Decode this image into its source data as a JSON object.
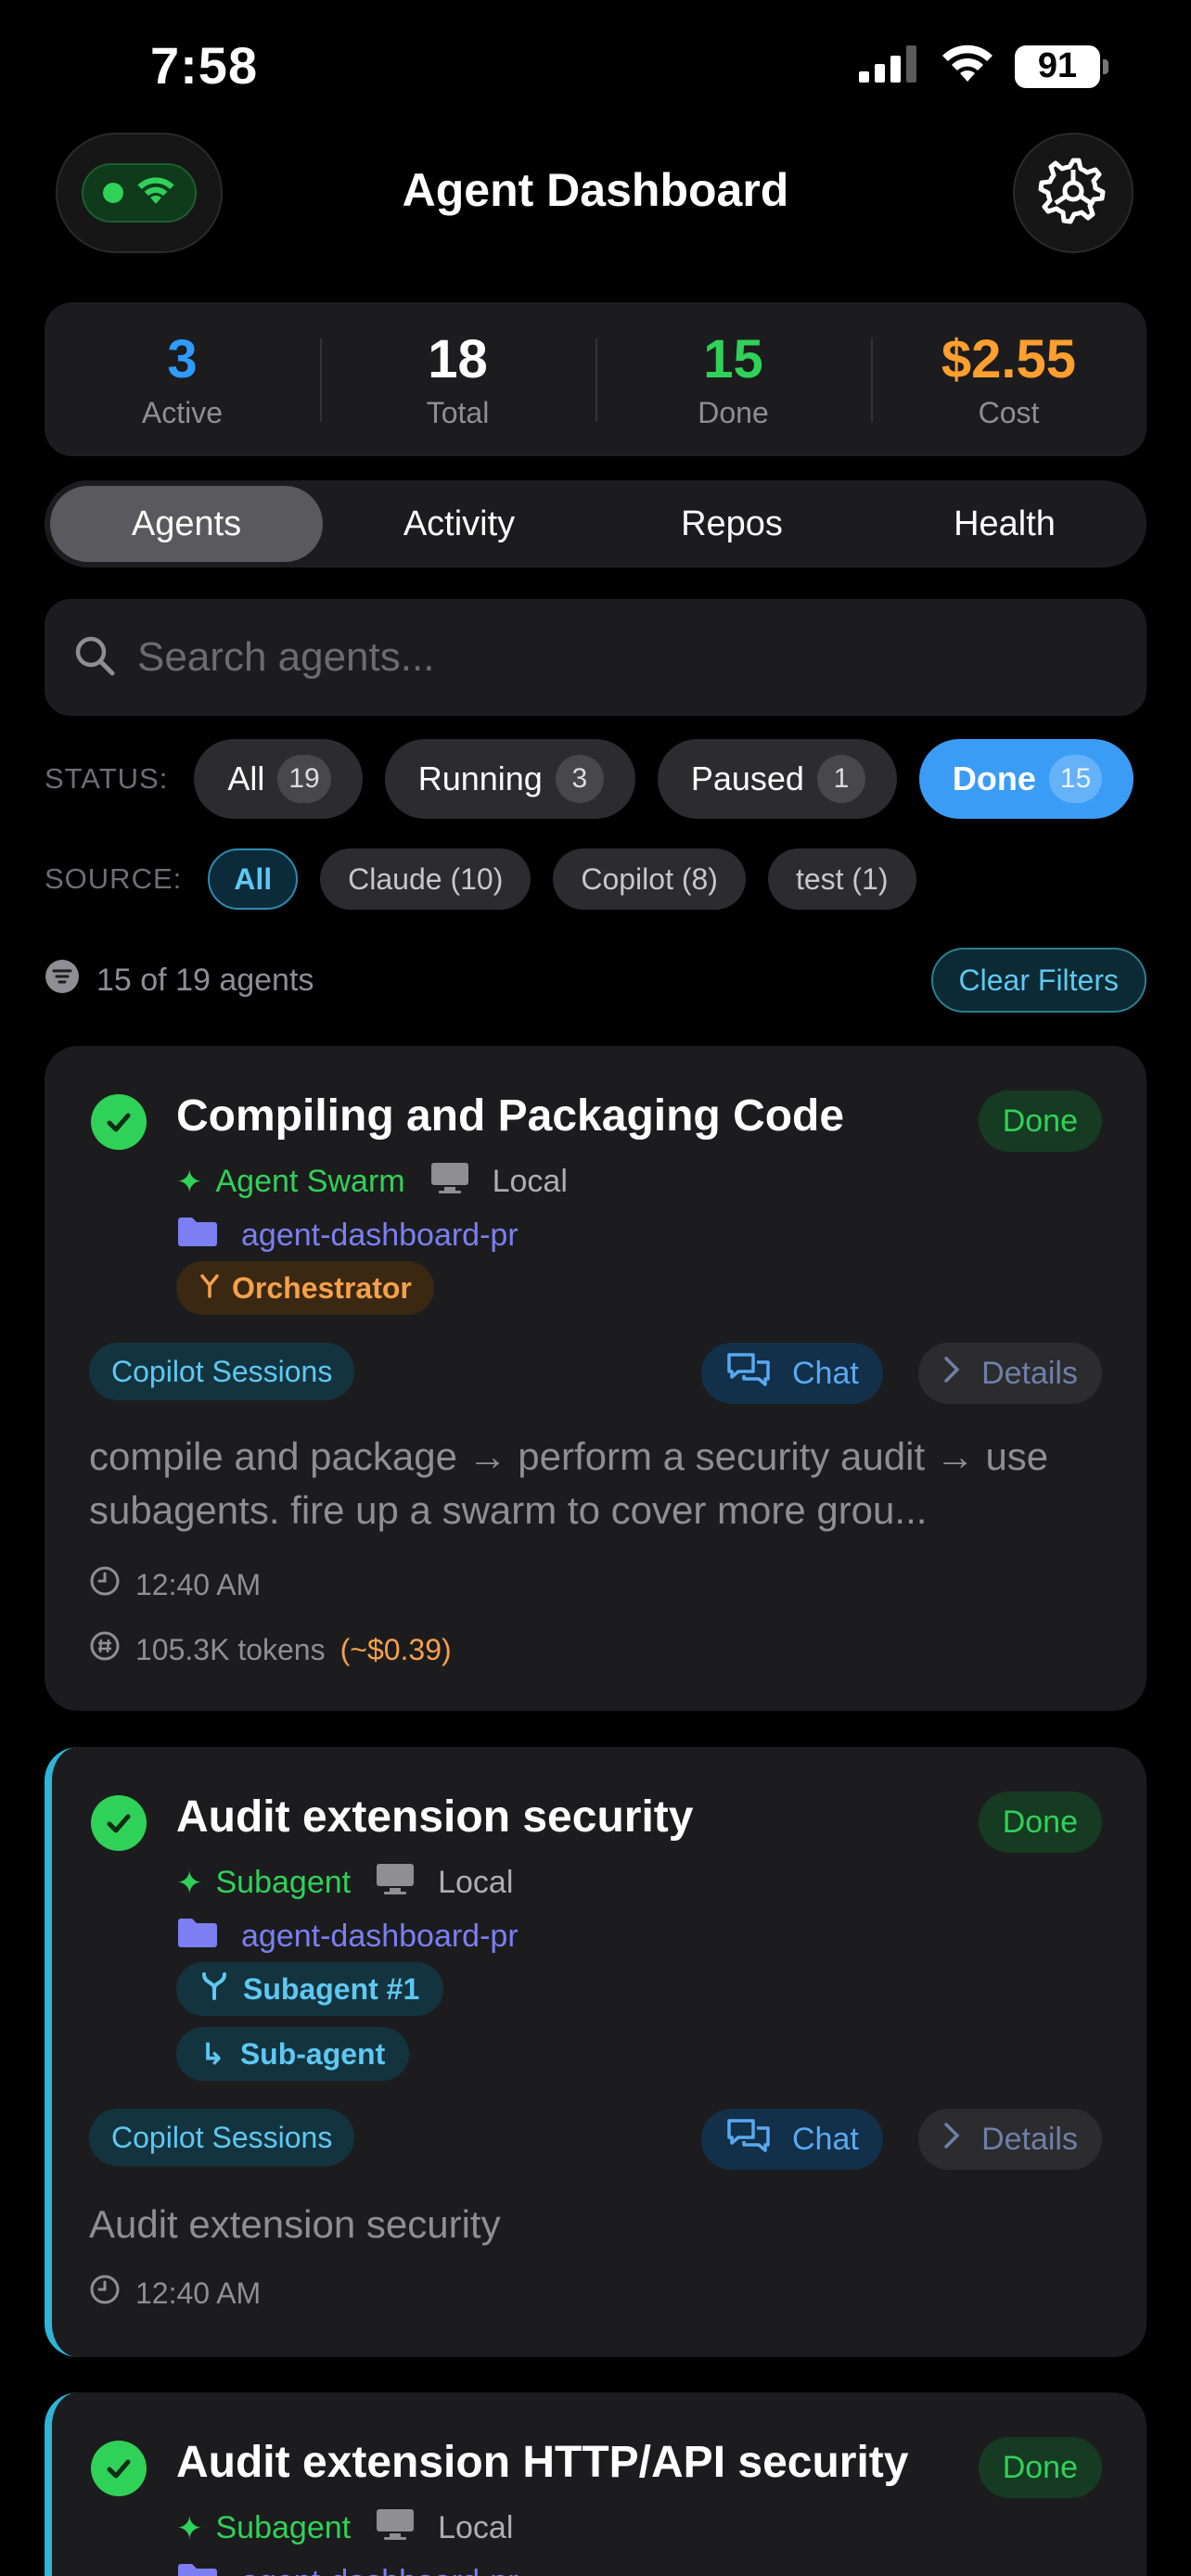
{
  "status_bar": {
    "time": "7:58",
    "battery": "91"
  },
  "header": {
    "title": "Agent Dashboard"
  },
  "stats": [
    {
      "value": "3",
      "label": "Active",
      "color": "#2f9bff"
    },
    {
      "value": "18",
      "label": "Total",
      "color": "#ffffff"
    },
    {
      "value": "15",
      "label": "Done",
      "color": "#30d158"
    },
    {
      "value": "$2.55",
      "label": "Cost",
      "color": "#ff9f2e"
    }
  ],
  "tabs": [
    "Agents",
    "Activity",
    "Repos",
    "Health"
  ],
  "active_tab": "Agents",
  "search": {
    "placeholder": "Search agents..."
  },
  "status_filter": {
    "label": "STATUS:",
    "chips": [
      {
        "label": "All",
        "count": "19"
      },
      {
        "label": "Running",
        "count": "3"
      },
      {
        "label": "Paused",
        "count": "1"
      },
      {
        "label": "Done",
        "count": "15"
      }
    ],
    "selected": "Done"
  },
  "source_filter": {
    "label": "SOURCE:",
    "chips": [
      "All",
      "Claude (10)",
      "Copilot (8)",
      "test (1)"
    ],
    "selected": "All"
  },
  "summary": {
    "count_text": "15 of 19 agents",
    "clear_label": "Clear Filters"
  },
  "cards": [
    {
      "title": "Compiling and Packaging Code",
      "status": "Done",
      "source": "Agent Swarm",
      "location": "Local",
      "repo": "agent-dashboard-pr",
      "role": "Orchestrator",
      "session_tag": "Copilot Sessions",
      "chat_label": "Chat",
      "details_label": "Details",
      "description": "compile and package → perform a security audit → use subagents. fire up a swarm to cover more grou...",
      "time": "12:40 AM",
      "tokens": "105.3K tokens",
      "cost": "(~$0.39)"
    },
    {
      "title": "Audit extension security",
      "status": "Done",
      "source": "Subagent",
      "location": "Local",
      "repo": "agent-dashboard-pr",
      "subagent_label": "Subagent #1",
      "subagent_type": "Sub-agent",
      "session_tag": "Copilot Sessions",
      "chat_label": "Chat",
      "details_label": "Details",
      "description": "Audit extension security",
      "time": "12:40 AM"
    },
    {
      "title": "Audit extension HTTP/API security",
      "status": "Done",
      "source": "Subagent",
      "location": "Local",
      "repo": "agent-dashboard-pr"
    }
  ]
}
